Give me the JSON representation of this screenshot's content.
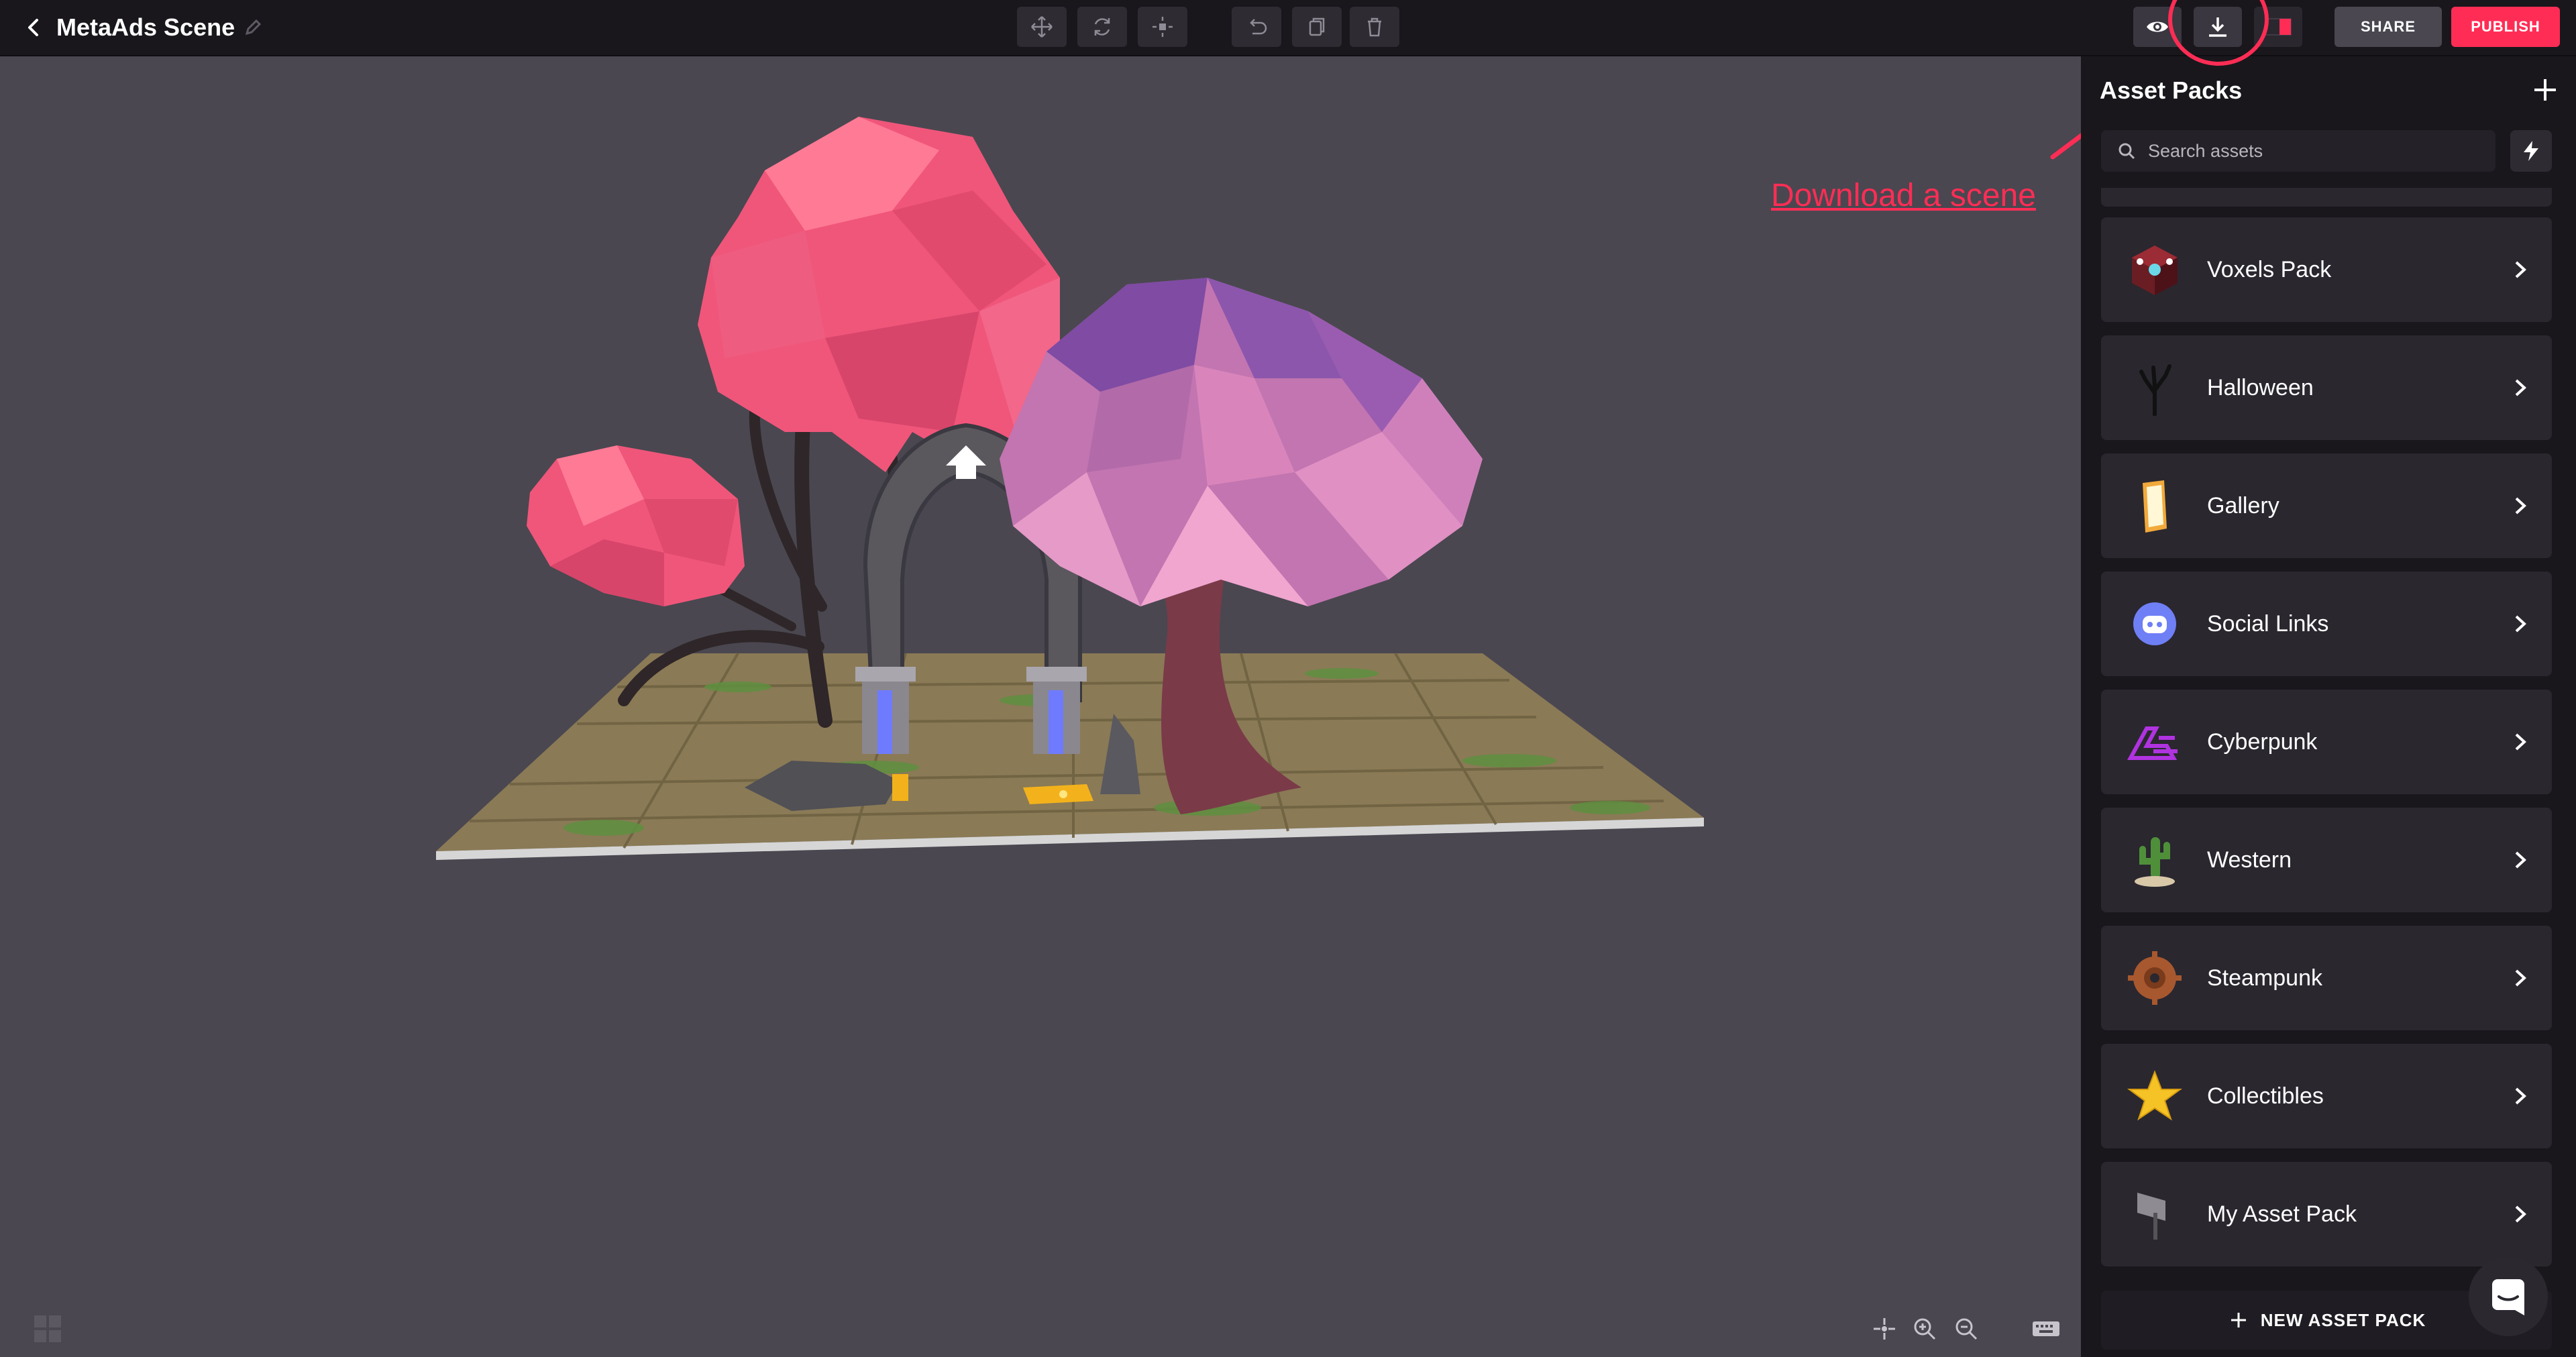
{
  "header": {
    "scene_title": "MetaAds Scene",
    "share_label": "SHARE",
    "publish_label": "PUBLISH"
  },
  "annotation": {
    "text": "Download a scene",
    "color": "#ff2d55"
  },
  "sidebar": {
    "title": "Asset Packs",
    "search": {
      "placeholder": "Search assets",
      "value": ""
    },
    "packs": [
      {
        "label": "Voxels Pack",
        "icon": "voxels-icon"
      },
      {
        "label": "Halloween",
        "icon": "halloween-tree-icon"
      },
      {
        "label": "Gallery",
        "icon": "gallery-frame-icon"
      },
      {
        "label": "Social Links",
        "icon": "discord-icon"
      },
      {
        "label": "Cyberpunk",
        "icon": "cyberpunk-logo-icon"
      },
      {
        "label": "Western",
        "icon": "cactus-icon"
      },
      {
        "label": "Steampunk",
        "icon": "gear-icon"
      },
      {
        "label": "Collectibles",
        "icon": "star-icon"
      },
      {
        "label": "My Asset Pack",
        "icon": "signpost-icon"
      }
    ],
    "new_pack_label": "NEW ASSET PACK"
  },
  "colors": {
    "accent": "#ff2d55",
    "background": "#4a4750",
    "panel": "#19171c",
    "card": "#2a272f"
  }
}
